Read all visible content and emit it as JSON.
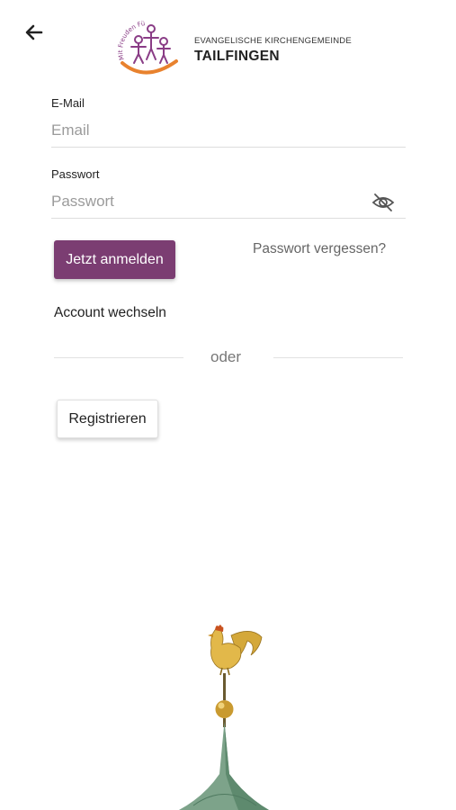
{
  "header": {
    "back_icon": "arrow-left-icon",
    "logo": {
      "arc_text": "Mit Freuden Für Kirche",
      "subtitle": "EVANGELISCHE KIRCHENGEMEINDE",
      "title": "TAILFINGEN",
      "colors": {
        "purple": "#8a3d86",
        "orange": "#e8822e"
      }
    }
  },
  "form": {
    "email_label": "E-Mail",
    "email_placeholder": "Email",
    "password_label": "Passwort",
    "password_placeholder": "Passwort",
    "password_toggle_icon": "eye-off-icon",
    "login_button": "Jetzt anmelden",
    "forgot_link": "Passwort vergessen?",
    "switch_account": "Account wechseln",
    "divider_text": "oder",
    "register_button": "Registrieren"
  },
  "colors": {
    "accent": "#7b3d72"
  },
  "footer_image": "church-spire-rooster"
}
